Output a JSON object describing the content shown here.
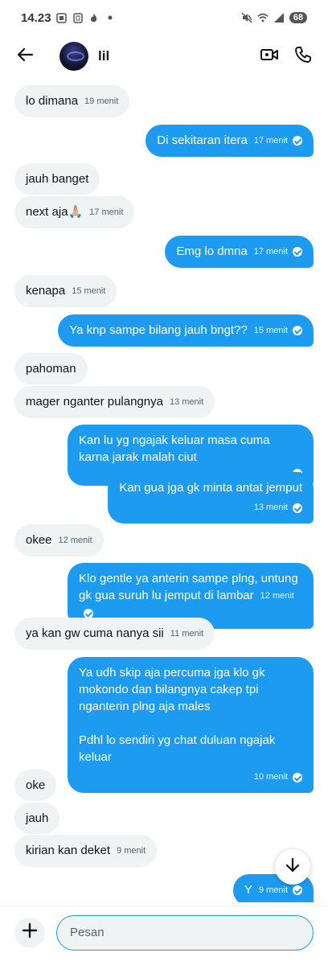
{
  "status": {
    "time": "14.23",
    "battery": "68",
    "icons": [
      "screenshot-icon",
      "sim-icon",
      "flame-icon",
      "dot-icon",
      "mute-icon",
      "wifi-icon",
      "signal-icon"
    ]
  },
  "header": {
    "contact_name": "lil",
    "icons": [
      "back-arrow-icon",
      "video-call-icon",
      "phone-call-icon"
    ]
  },
  "messages": [
    {
      "dir": "in",
      "text": "lo dimana",
      "time": "19 menit"
    },
    {
      "dir": "out",
      "text": "Di sekitaran itera",
      "time": "17 menit"
    },
    {
      "dir": "in",
      "text": "jauh banget",
      "time": ""
    },
    {
      "dir": "in",
      "text": "next aja🙏🏼",
      "time": "17 menit"
    },
    {
      "dir": "out",
      "text": "Emg lo dmna",
      "time": "17 menit"
    },
    {
      "dir": "in",
      "text": "kenapa",
      "time": "15 menit"
    },
    {
      "dir": "out",
      "text": "Ya knp sampe bilang jauh bngt??",
      "time": "15 menit"
    },
    {
      "dir": "in",
      "text": "pahoman",
      "time": ""
    },
    {
      "dir": "in",
      "text": "mager nganter pulangnya",
      "time": "13 menit"
    },
    {
      "dir": "out",
      "text": "Kan lu yg ngajak keluar masa cuma karna jarak malah ciut",
      "time": ""
    },
    {
      "dir": "out",
      "text": "Kan gua jga gk minta antat jemput",
      "time": "13 menit"
    },
    {
      "dir": "in",
      "text": "okee",
      "time": "12 menit"
    },
    {
      "dir": "out",
      "text": "Klo gentle ya anterin sampe plng, untung gk gua suruh lu jemput di lambar",
      "time": "12 menit"
    },
    {
      "dir": "in",
      "text": "ya kan gw cuma nanya sii",
      "time": "11 menit"
    },
    {
      "dir": "out",
      "text": "Ya udh skip aja percuma jga klo gk mokondo dan bilangnya cakep tpi nganterin plng aja males",
      "text2": "Pdhl lo sendiri yg chat duluan ngajak keluar",
      "time": "10 menit"
    },
    {
      "dir": "in",
      "text": "oke",
      "time": ""
    },
    {
      "dir": "in",
      "text": "jauh",
      "time": ""
    },
    {
      "dir": "in",
      "text": "kirian kan deket",
      "time": "9 menit"
    },
    {
      "dir": "out",
      "text": "Y",
      "time": "9 menit"
    }
  ],
  "composer": {
    "placeholder": "Pesan"
  },
  "colors": {
    "outgoing_bubble": "#1d9bf0",
    "incoming_bubble": "#eff3f4",
    "text": "#0f1419",
    "muted": "#536471"
  }
}
